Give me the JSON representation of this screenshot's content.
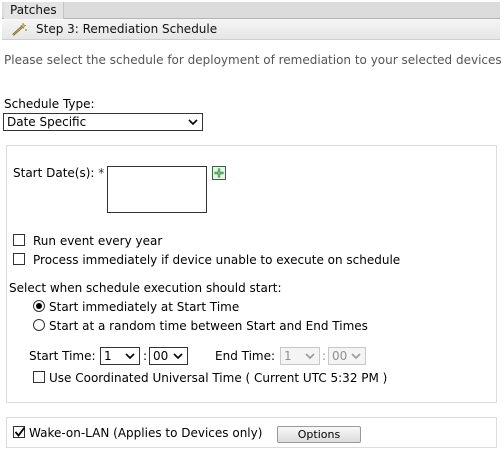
{
  "tabs": {
    "patches": "Patches"
  },
  "step": {
    "title": "Step 3: Remediation Schedule",
    "icon": "wand-icon"
  },
  "intro": "Please select the schedule for deployment of remediation to your selected devices",
  "schedule_type": {
    "label": "Schedule Type:",
    "value": "Date Specific"
  },
  "start_dates": {
    "label": "Start Date(s):",
    "required_mark": "*",
    "add_icon": "add-date-icon"
  },
  "options": {
    "run_every_year": {
      "label": "Run event every year",
      "checked": false
    },
    "process_immediately": {
      "label": "Process immediately if device unable to execute on schedule",
      "checked": false
    }
  },
  "execution": {
    "label": "Select when schedule execution should start:",
    "immediately": {
      "label": "Start immediately at Start Time",
      "selected": true
    },
    "random": {
      "label": "Start at a random time between Start and End Times",
      "selected": false
    }
  },
  "start_time": {
    "label": "Start Time:",
    "hour": "1",
    "separator": ":",
    "minute": "00"
  },
  "end_time": {
    "label": "End Time:",
    "hour": "1",
    "separator": ":",
    "minute": "00"
  },
  "utc": {
    "label": "Use Coordinated Universal Time ( Current UTC 5:32 PM )",
    "checked": false
  },
  "wol": {
    "label": "Wake-on-LAN (Applies to Devices only)",
    "checked": true,
    "button": "Options"
  },
  "colors": {
    "intro_text": "#555555",
    "add_icon": "#2e8b3a",
    "disabled": "#8f8f8f"
  }
}
